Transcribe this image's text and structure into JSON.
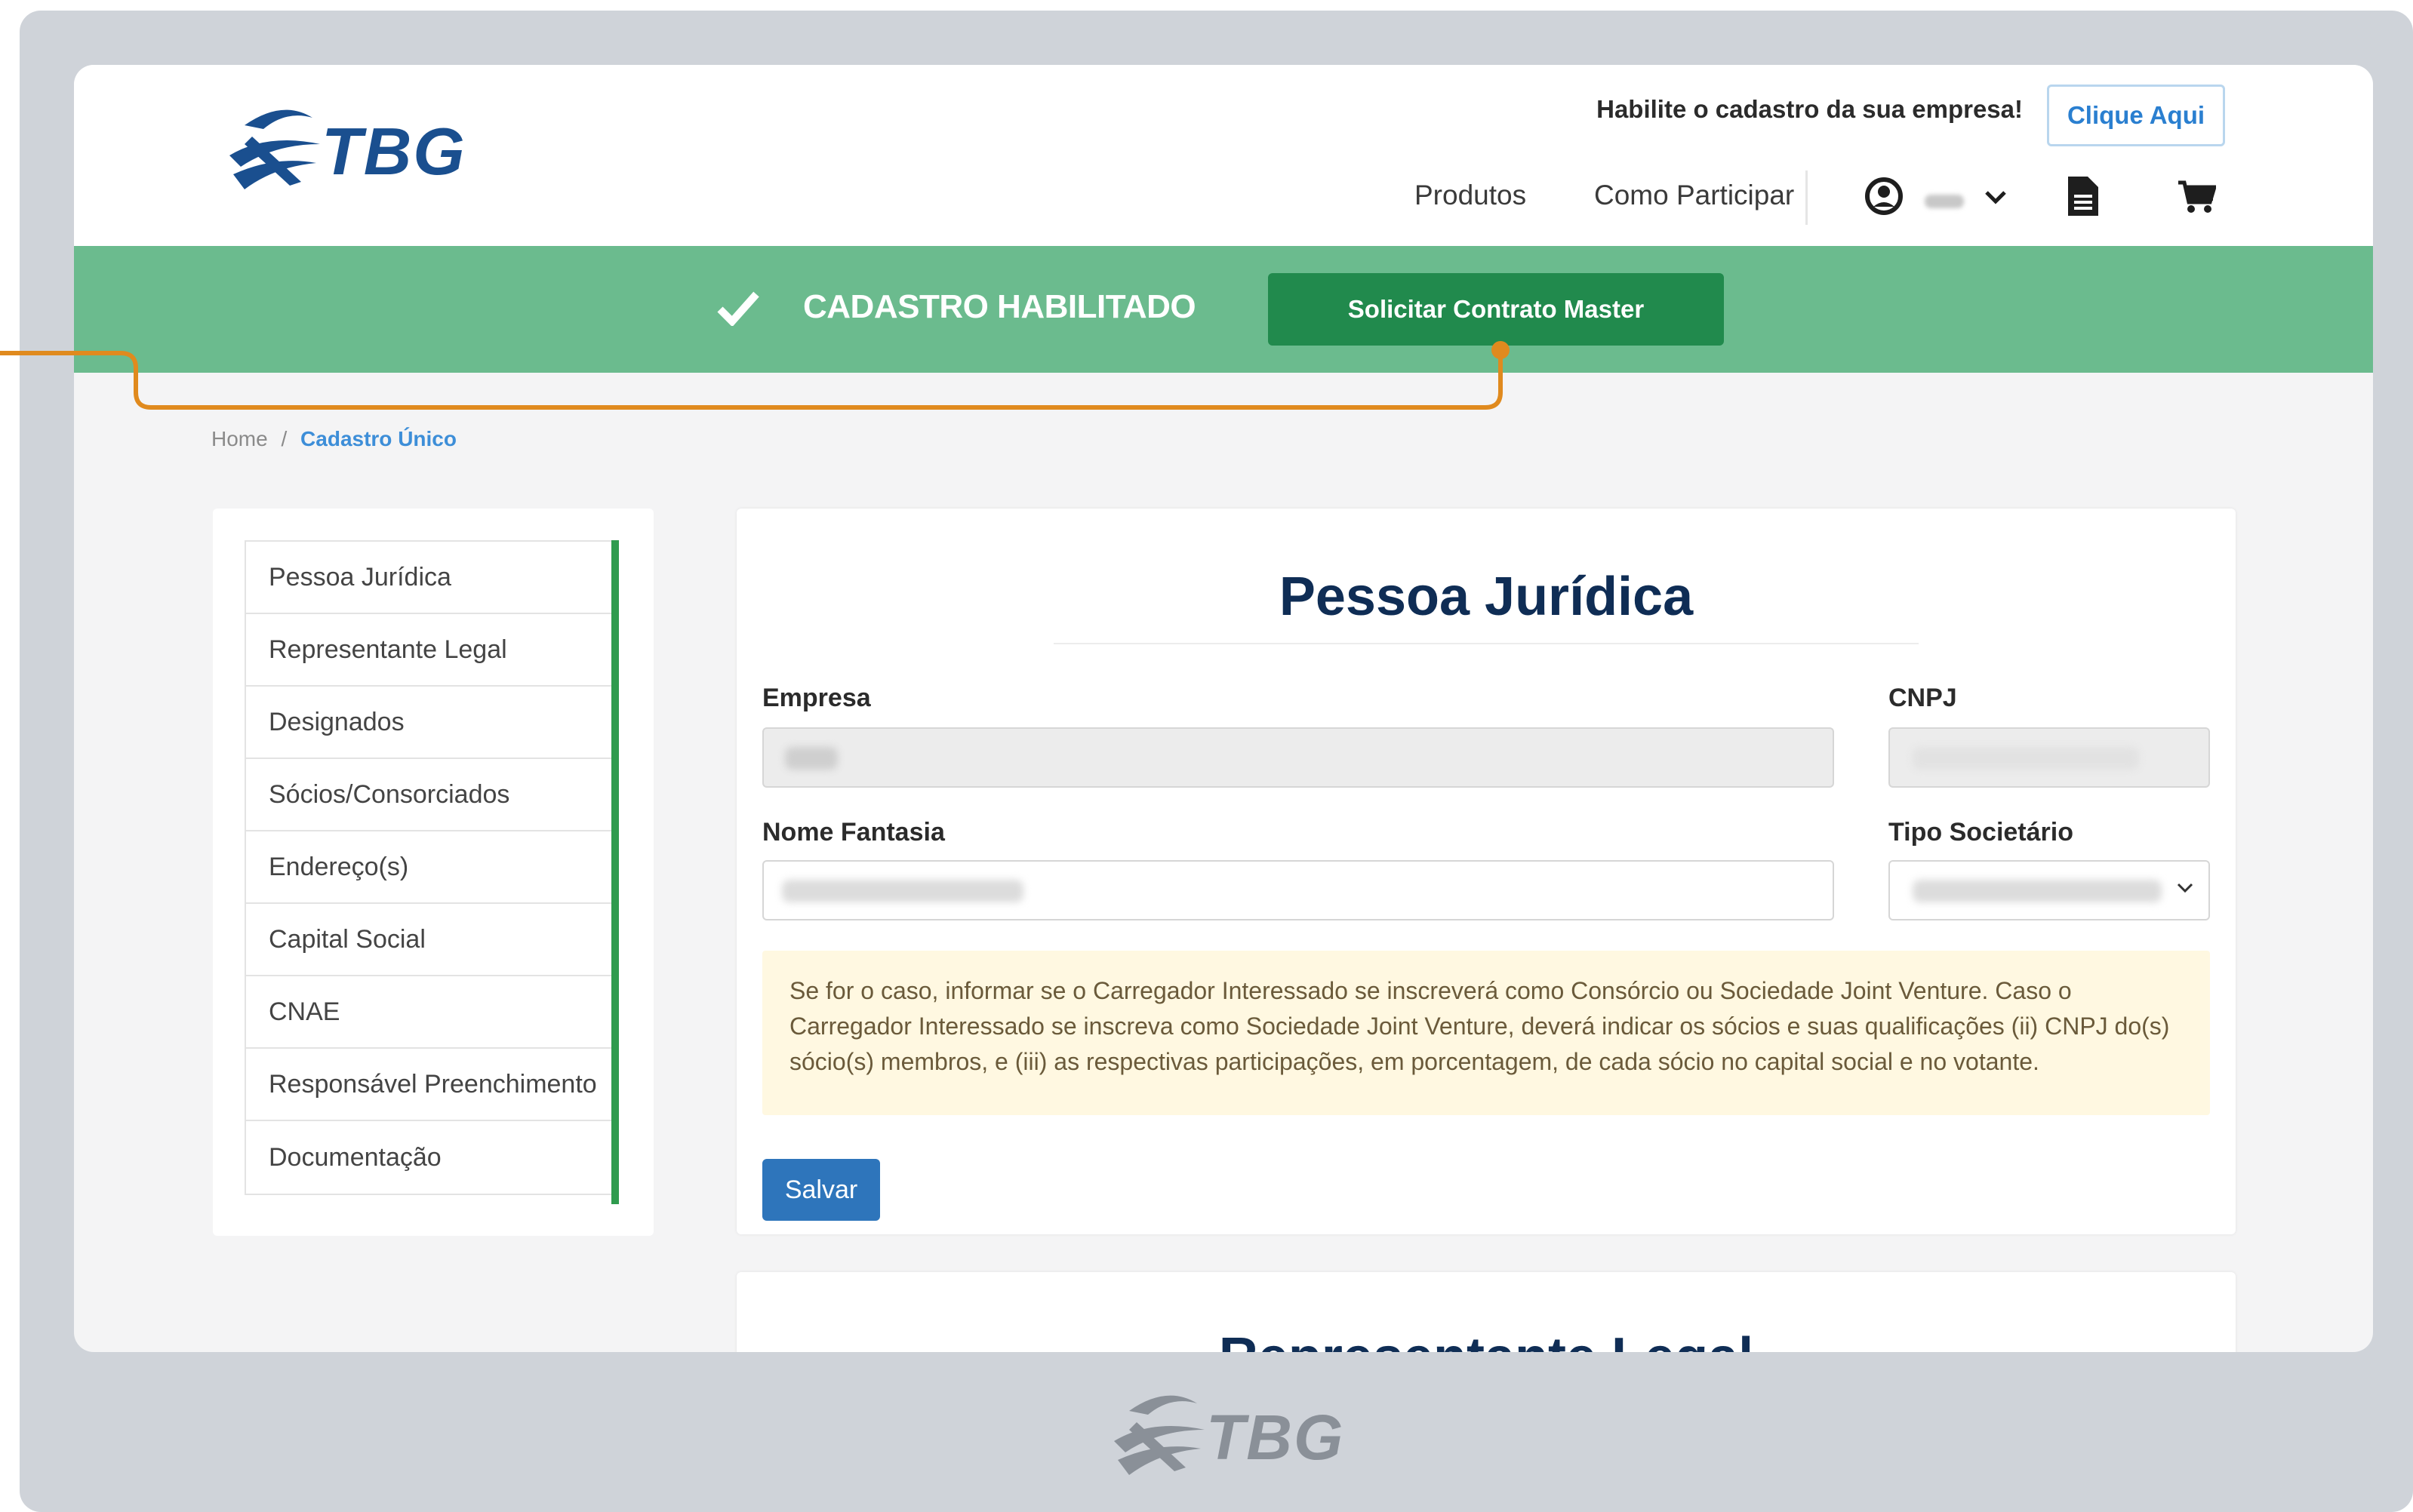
{
  "header": {
    "logo_text": "TBG",
    "promo_text": "Habilite o cadastro da sua empresa!",
    "promo_button": "Clique Aqui",
    "nav": [
      "Produtos",
      "Como Participar"
    ],
    "icons": [
      "user-icon",
      "chevron-down-icon",
      "document-icon",
      "cart-icon"
    ]
  },
  "status_bar": {
    "status": "CADASTRO HABILITADO",
    "action": "Solicitar Contrato Master",
    "color": "#6bbb8e",
    "button_color": "#218a4d"
  },
  "breadcrumb": {
    "home": "Home",
    "separator": "/",
    "current": "Cadastro Único"
  },
  "sidebar": {
    "items": [
      "Pessoa Jurídica",
      "Representante Legal",
      "Designados",
      "Sócios/Consorciados",
      "Endereço(s)",
      "Capital Social",
      "CNAE",
      "Responsável Preenchimento",
      "Documentação"
    ],
    "accent": "#2f9b4e"
  },
  "form": {
    "title": "Pessoa Jurídica",
    "empresa_label": "Empresa",
    "cnpj_label": "CNPJ",
    "nome_fantasia_label": "Nome Fantasia",
    "tipo_societario_label": "Tipo Societário",
    "notice": "Se for o caso, informar se o Carregador Interessado se inscreverá como Consórcio ou Sociedade Joint Venture. Caso o Carregador Interessado se inscreva como Sociedade Joint Venture, deverá indicar os sócios e suas qualificações (ii) CNPJ do(s) sócio(s) membros, e (iii) as respectivas participações, em porcentagem, de cada sócio no capital social e no votante.",
    "save_button": "Salvar"
  },
  "next_section": {
    "title": "Representante Legal"
  },
  "footer": {
    "logo_text": "TBG"
  }
}
